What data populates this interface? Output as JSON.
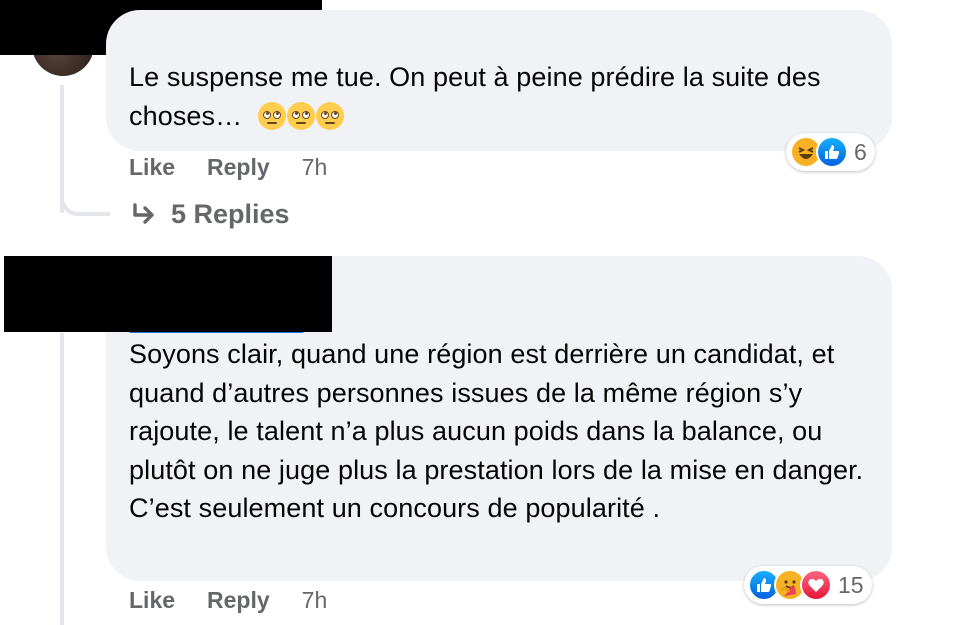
{
  "comment1": {
    "text": "Le suspense me tue. On peut à peine prédire la suite des choses…",
    "inline_emoji": [
      "face-with-rolling-eyes",
      "face-with-rolling-eyes",
      "face-with-rolling-eyes"
    ],
    "reactions": {
      "icons": [
        "haha-icon",
        "like-icon"
      ],
      "count": "6"
    },
    "actions": {
      "like": "Like",
      "reply": "Reply",
      "time": "7h"
    },
    "replies_label": "5 Replies"
  },
  "comment2": {
    "text": "Soyons clair, quand une région est derrière un candidat, et quand d’autres personnes issues de la même région s’y rajoute, le talent n’a plus aucun poids dans la balance, ou plutôt on ne juge plus la prestation lors de la mise en danger. C’est seulement un concours de popularité .",
    "reactions": {
      "icons": [
        "like-icon",
        "care-icon",
        "love-icon"
      ],
      "count": "15"
    },
    "actions": {
      "like": "Like",
      "reply": "Reply",
      "time": "7h"
    }
  },
  "colors": {
    "bubble": "#f0f2f5",
    "text": "#050505",
    "secondary": "#65676b",
    "like_blue": "#1877f2",
    "love_red": "#f33e58",
    "emoji_yellow": "#f7b125"
  }
}
